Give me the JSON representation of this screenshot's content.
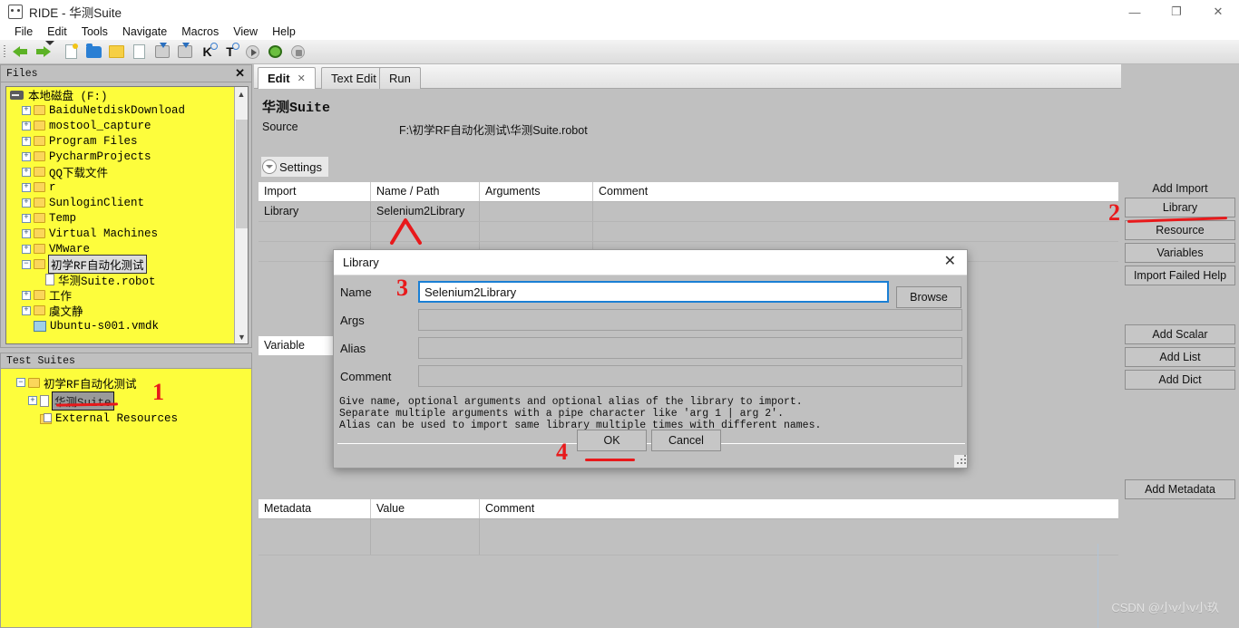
{
  "window": {
    "title": "RIDE - 华测Suite",
    "app_icon": "robot-icon",
    "controls": {
      "minimize": "—",
      "maximize": "❐",
      "close": "✕"
    }
  },
  "menubar": {
    "items": [
      "File",
      "Edit",
      "Tools",
      "Navigate",
      "Macros",
      "View",
      "Help"
    ]
  },
  "toolbar": {
    "icons": [
      "back-arrow-icon",
      "forward-arrow-icon",
      "new-project-icon",
      "open-folder-icon",
      "new-suite-icon",
      "new-file-icon",
      "save-icon",
      "save-all-icon",
      "search-keyword-icon",
      "search-test-icon",
      "run-icon",
      "debug-icon",
      "stop-icon"
    ]
  },
  "files_panel": {
    "title": "Files",
    "close_label": "✕",
    "tree": [
      {
        "label": "本地磁盘 (F:)",
        "icon": "drive-icon",
        "indent": 0,
        "expander": ""
      },
      {
        "label": "BaiduNetdiskDownload",
        "icon": "folder-icon",
        "indent": 1,
        "expander": "+"
      },
      {
        "label": "mostool_capture",
        "icon": "folder-icon",
        "indent": 1,
        "expander": "+"
      },
      {
        "label": "Program Files",
        "icon": "folder-icon",
        "indent": 1,
        "expander": "+"
      },
      {
        "label": "PycharmProjects",
        "icon": "folder-icon",
        "indent": 1,
        "expander": "+"
      },
      {
        "label": "QQ下载文件",
        "icon": "folder-icon",
        "indent": 1,
        "expander": "+"
      },
      {
        "label": "r",
        "icon": "folder-icon",
        "indent": 1,
        "expander": "+"
      },
      {
        "label": "SunloginClient",
        "icon": "folder-icon",
        "indent": 1,
        "expander": "+"
      },
      {
        "label": "Temp",
        "icon": "folder-icon",
        "indent": 1,
        "expander": "+"
      },
      {
        "label": "Virtual Machines",
        "icon": "folder-icon",
        "indent": 1,
        "expander": "+"
      },
      {
        "label": "VMware",
        "icon": "folder-icon",
        "indent": 1,
        "expander": "+"
      },
      {
        "label": "初学RF自动化测试",
        "icon": "folder-icon",
        "indent": 1,
        "expander": "−",
        "selected": true
      },
      {
        "label": "华测Suite.robot",
        "icon": "file-icon",
        "indent": 2,
        "expander": ""
      },
      {
        "label": "工作",
        "icon": "folder-icon",
        "indent": 1,
        "expander": "+"
      },
      {
        "label": "虞文静",
        "icon": "folder-icon",
        "indent": 1,
        "expander": "+"
      },
      {
        "label": "Ubuntu-s001.vmdk",
        "icon": "vmdk-icon",
        "indent": 1,
        "expander": ""
      }
    ]
  },
  "test_suites_panel": {
    "title": "Test Suites",
    "tree": [
      {
        "label": "初学RF自动化测试",
        "icon": "folder-icon",
        "indent": 0,
        "expander": "−"
      },
      {
        "label": "华测Suite",
        "icon": "file-icon",
        "indent": 1,
        "expander": "+",
        "selected": true
      },
      {
        "label": "External Resources",
        "icon": "resource-folder-icon",
        "indent": 1,
        "expander": ""
      }
    ]
  },
  "editor": {
    "tabs": [
      {
        "label": "Edit",
        "active": true,
        "closable": true
      },
      {
        "label": "Text Edit",
        "active": false,
        "closable": false
      },
      {
        "label": "Run",
        "active": false,
        "closable": false
      }
    ],
    "tab_overflow_icon": "chevron-down-icon",
    "suite_title": "华测Suite",
    "source_label": "Source",
    "source_value": "F:\\初学RF自动化测试\\华测Suite.robot",
    "settings_label": "Settings",
    "settings_toggle_icon": "chevron-down-circle-icon",
    "import_table": {
      "headers": [
        "Import",
        "Name / Path",
        "Arguments",
        "Comment"
      ],
      "rows": [
        [
          "Library",
          "Selenium2Library",
          "",
          ""
        ]
      ]
    },
    "variable_label": "Variable",
    "metadata_table": {
      "headers": [
        "Metadata",
        "Value",
        "Comment"
      ],
      "rows": [
        [
          "",
          "",
          ""
        ]
      ]
    }
  },
  "right_panel": {
    "add_import_title": "Add Import",
    "import_buttons": [
      "Library",
      "Resource",
      "Variables",
      "Import Failed Help"
    ],
    "variable_buttons": [
      "Add Scalar",
      "Add List",
      "Add Dict"
    ],
    "metadata_button": "Add Metadata"
  },
  "dialog": {
    "title": "Library",
    "close_label": "✕",
    "fields": [
      {
        "label": "Name",
        "value": "Selenium2Library",
        "placeholder": "",
        "focused": true
      },
      {
        "label": "Args",
        "value": "",
        "placeholder": "",
        "focused": false
      },
      {
        "label": "Alias",
        "value": "",
        "placeholder": "",
        "focused": false
      },
      {
        "label": "Comment",
        "value": "",
        "placeholder": "",
        "focused": false
      }
    ],
    "browse_label": "Browse",
    "help_lines": [
      "Give name, optional arguments and optional alias of the library to import.",
      "Separate multiple arguments with a pipe character like 'arg 1 | arg 2'.",
      "Alias can be used to import same library multiple times with different names."
    ],
    "ok_label": "OK",
    "cancel_label": "Cancel",
    "resize_grip_icon": "resize-grip-icon"
  },
  "annotations": {
    "markers": [
      {
        "number": "1",
        "target": "test-suite-item"
      },
      {
        "number": "2",
        "target": "add-import-library-button"
      },
      {
        "number": "3",
        "target": "dialog-name-field"
      },
      {
        "number": "4",
        "target": "dialog-ok-button"
      }
    ],
    "color": "#e8191b"
  },
  "watermark": {
    "text": "CSDN @小v小v小玖"
  }
}
